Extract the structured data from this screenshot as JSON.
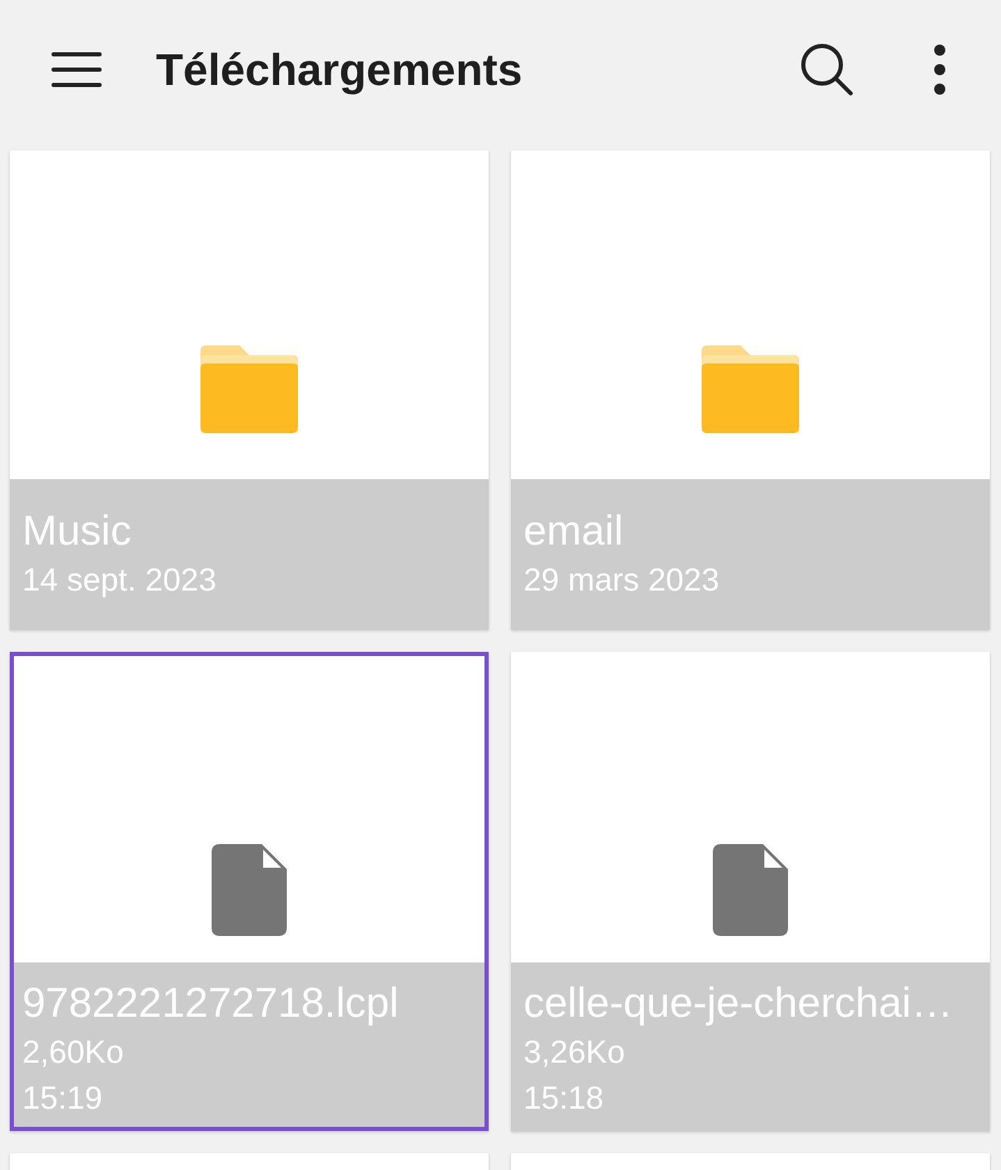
{
  "app_bar": {
    "title": "Téléchargements"
  },
  "grid": {
    "items": [
      {
        "kind": "folder",
        "name": "Music",
        "date": "14 sept. 2023",
        "selected": false
      },
      {
        "kind": "folder",
        "name": "email",
        "date": "29 mars 2023",
        "selected": false
      },
      {
        "kind": "file",
        "name": "9782221272718.lcpl",
        "size": "2,60Ko",
        "time": "15:19",
        "selected": true
      },
      {
        "kind": "file",
        "name": "celle-que-je-cherchai…",
        "size": "3,26Ko",
        "time": "15:18",
        "selected": false
      }
    ]
  }
}
